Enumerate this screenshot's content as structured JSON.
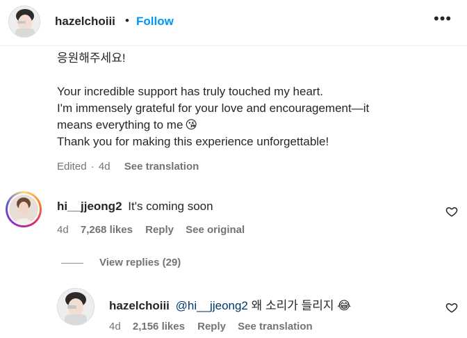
{
  "header": {
    "username": "hazelchoiii",
    "separator": "•",
    "follow_label": "Follow",
    "more_label": "•••"
  },
  "caption": {
    "lines": [
      "응원해주세요!",
      "Your incredible support has truly touched my heart.",
      "I'm immensely grateful for your love and encouragement—it",
      "means everything to me",
      "Thank you for making this experience unforgettable!"
    ],
    "emoji": "😘",
    "edited": "Edited",
    "dot": "·",
    "time": "4d",
    "see_translation": "See translation"
  },
  "comments": [
    {
      "username": "hi__jjeong2",
      "text": "It's coming soon",
      "time": "4d",
      "likes": "7,268 likes",
      "reply_label": "Reply",
      "extra_label": "See original"
    },
    {
      "username": "hazelchoiii",
      "mention": "@hi__jjeong2",
      "text": "왜 소리가 들리지",
      "emoji": "😂",
      "time": "4d",
      "likes": "2,156 likes",
      "reply_label": "Reply",
      "extra_label": "See translation"
    }
  ],
  "view_replies": "View replies (29)",
  "icons": {
    "like": "heart-outline-icon",
    "more": "more-horizontal-icon"
  },
  "colors": {
    "accent": "#0095f6",
    "mention": "#00376b",
    "muted": "#737373"
  }
}
